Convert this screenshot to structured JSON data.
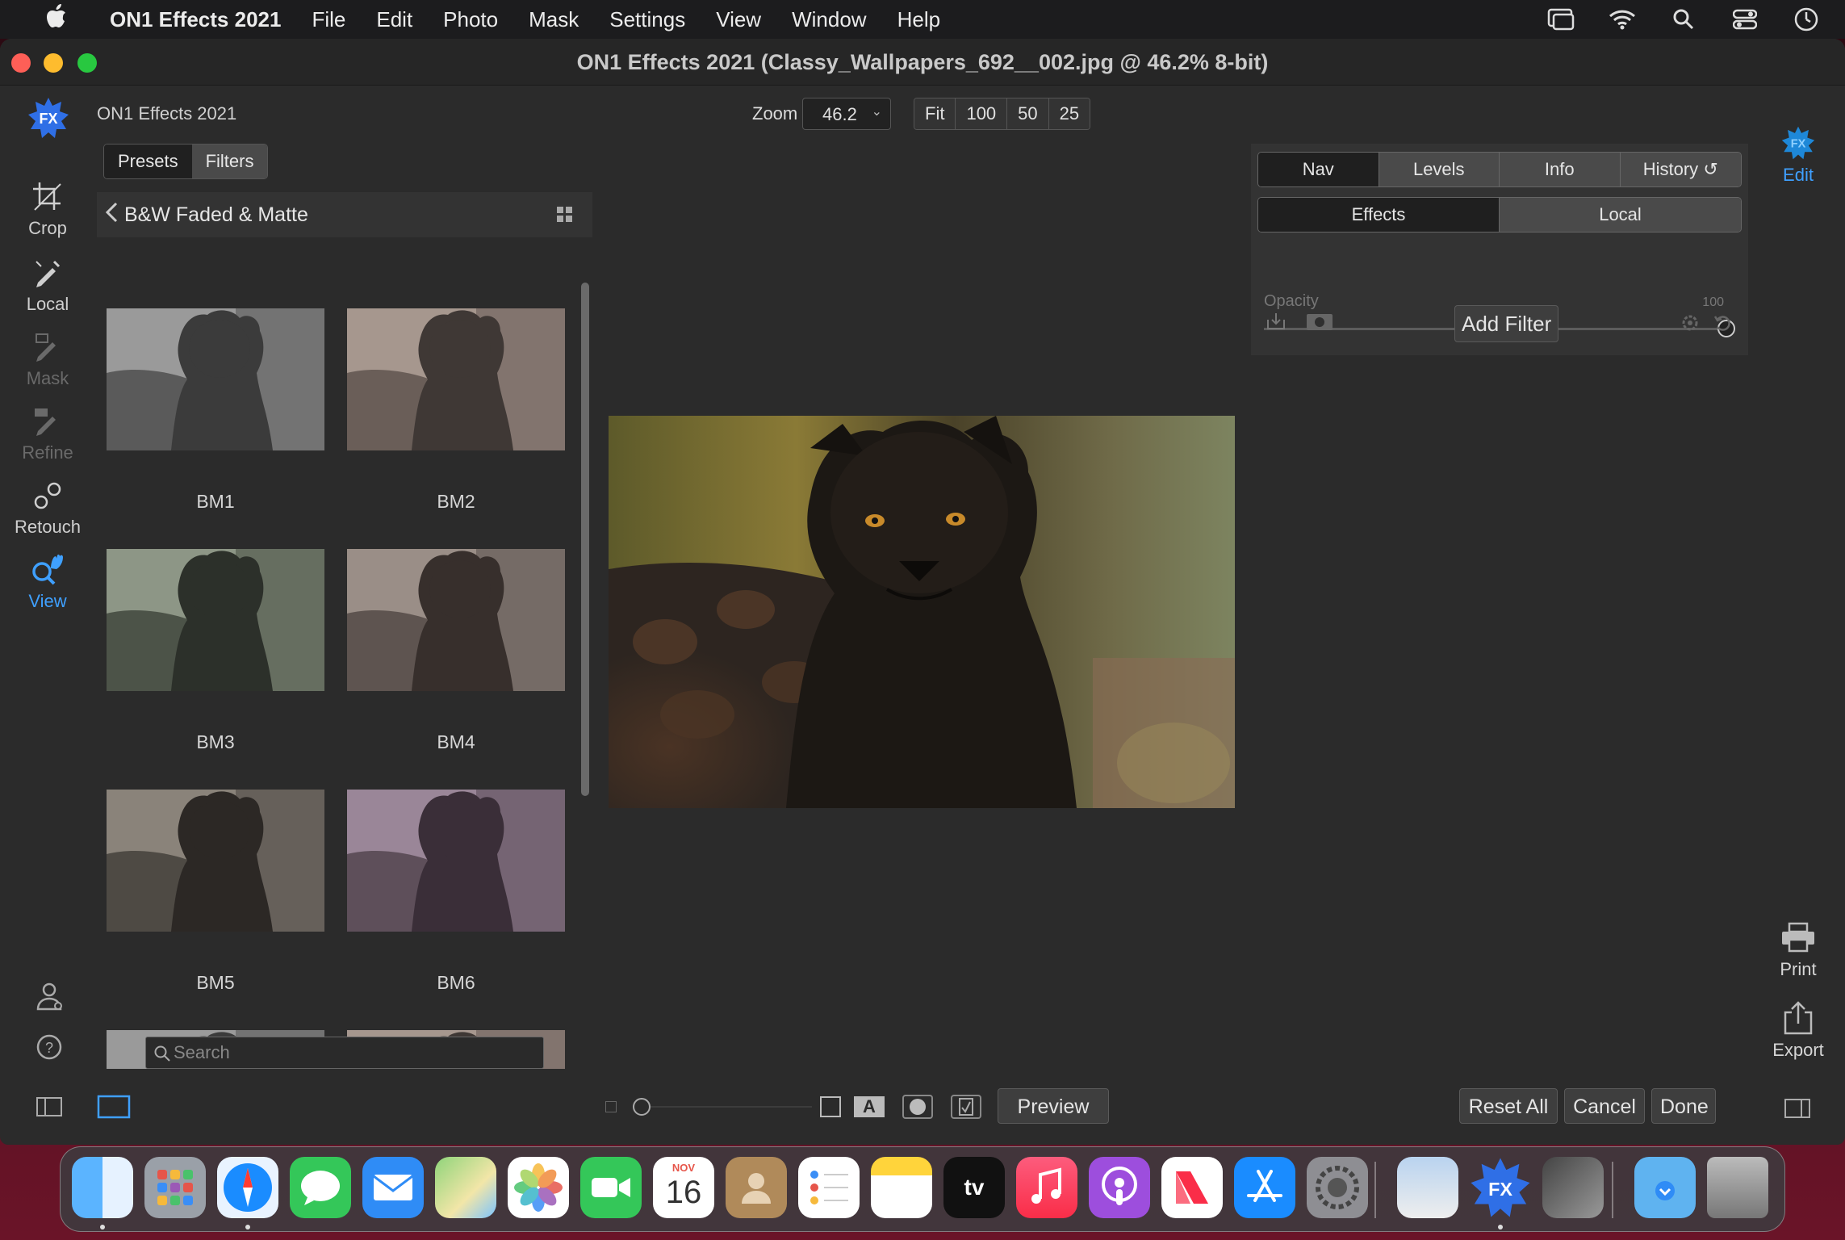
{
  "menubar": {
    "app_name": "ON1 Effects 2021",
    "items": [
      "File",
      "Edit",
      "Photo",
      "Mask",
      "Settings",
      "View",
      "Window",
      "Help"
    ]
  },
  "window": {
    "title": "ON1 Effects 2021 (Classy_Wallpapers_692__002.jpg @ 46.2% 8-bit)"
  },
  "header": {
    "app_name": "ON1 Effects 2021",
    "logo_text": "FX",
    "zoom_label": "Zoom",
    "zoom_value": "46.2",
    "zoom_buttons": [
      "Fit",
      "100",
      "50",
      "25"
    ]
  },
  "tools": {
    "crop": "Crop",
    "local": "Local",
    "mask": "Mask",
    "refine": "Refine",
    "retouch": "Retouch",
    "view": "View"
  },
  "browser": {
    "tabs": [
      "Presets",
      "Filters"
    ],
    "active_tab": "Presets",
    "category": "B&W Faded & Matte",
    "presets": [
      "BM1",
      "BM2",
      "BM3",
      "BM4",
      "BM5",
      "BM6"
    ],
    "search_placeholder": "Search"
  },
  "right_panel": {
    "tabs": [
      "Nav",
      "Levels",
      "Info",
      "History"
    ],
    "mode_tabs": [
      "Effects",
      "Local"
    ],
    "opacity_label": "Opacity",
    "opacity_value": "100",
    "add_filter": "Add Filter"
  },
  "right_rail": {
    "edit": "Edit",
    "edit_logo": "FX",
    "print": "Print",
    "export": "Export"
  },
  "bottom_bar": {
    "preview": "Preview",
    "reset_all": "Reset All",
    "cancel": "Cancel",
    "done": "Done"
  },
  "dock": {
    "calendar_month": "NOV",
    "calendar_day": "16",
    "tv_label": "tv",
    "fx_label": "FX"
  },
  "colors": {
    "accent": "#3fa0ff",
    "window_bg": "#2b2b2b",
    "panel_bg": "#333333"
  }
}
